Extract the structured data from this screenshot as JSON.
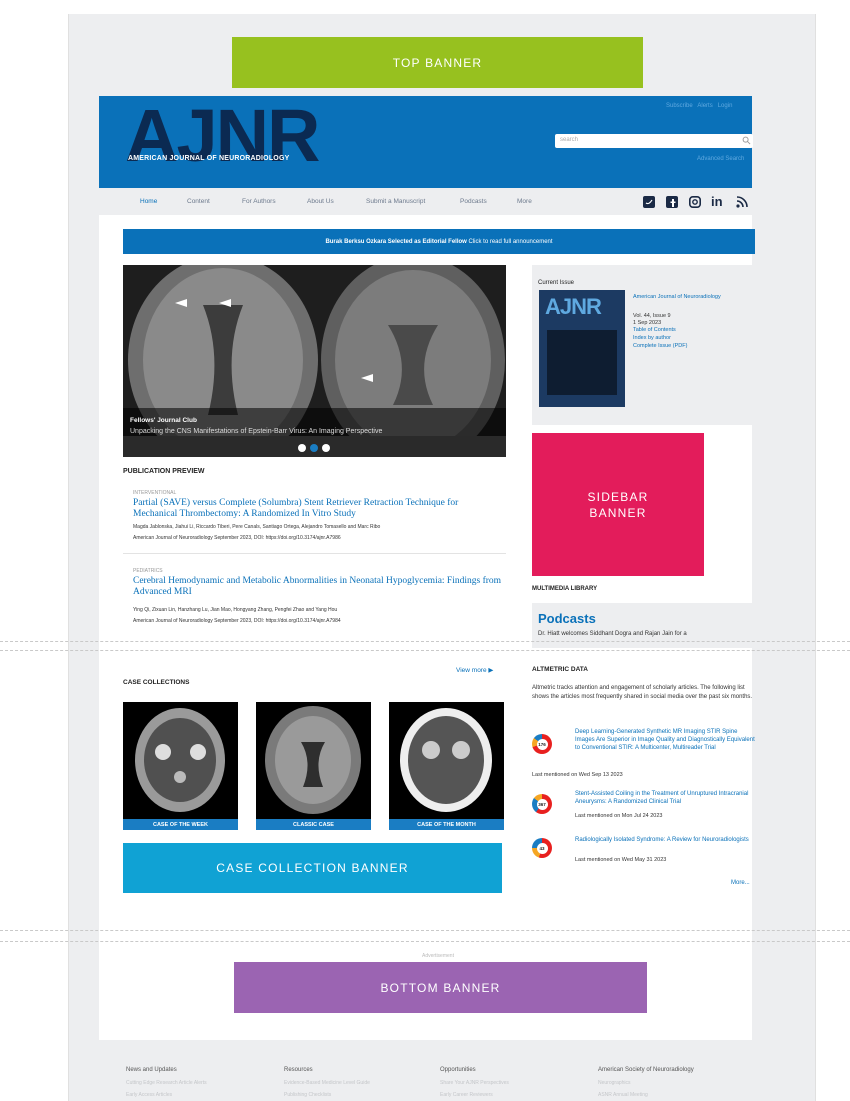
{
  "banners": {
    "top": "TOP BANNER",
    "sidebar": "SIDEBAR\nBANNER",
    "case_collection": "CASE COLLECTION BANNER",
    "bottom": "BOTTOM BANNER",
    "advertisement": "Advertisement"
  },
  "header": {
    "logo": "AJNR",
    "logo_subtitle": "AMERICAN JOURNAL OF NEURORADIOLOGY",
    "utility_links": [
      "Subscribe",
      "Alerts",
      "Login"
    ],
    "search_placeholder": "search",
    "advanced_search": "Advanced Search"
  },
  "nav": {
    "items": [
      "Home",
      "Content",
      "For Authors",
      "About Us",
      "Submit a Manuscript",
      "Podcasts",
      "More"
    ],
    "social_icons": [
      "twitter-icon",
      "facebook-icon",
      "instagram-icon",
      "linkedin-icon",
      "rss-icon"
    ]
  },
  "announcement": {
    "bold": "Burak Berksu Ozkara Selected as Editorial Fellow",
    "link": "Click to read full announcement"
  },
  "carousel": {
    "caption_title": "Fellows' Journal Club",
    "caption_subtitle": "Unpacking the CNS Manifestations of Epstein-Barr Virus: An Imaging Perspective"
  },
  "publication_preview": {
    "heading": "PUBLICATION PREVIEW",
    "articles": [
      {
        "category": "INTERVENTIONAL",
        "title": "Partial (SAVE) versus Complete (Solumbra) Stent Retriever Retraction Technique for Mechanical Thrombectomy: A Randomized In Vitro Study",
        "authors": "Magda Jablonska, Jiahui Li, Riccardo Tiberi, Pere Canals, Santiago Ortega, Alejandro Tomasello and Marc Ribo",
        "citation": "American Journal of Neuroradiology September 2023, DOI: https://doi.org/10.3174/ajnr.A7986"
      },
      {
        "category": "PEDIATRICS",
        "title": "Cerebral Hemodynamic and Metabolic Abnormalities in Neonatal Hypoglycemia: Findings from Advanced MRI",
        "authors": "Ying Qi, Zixuan Lin, Hanzhang Lu, Jian Mao, Hongyang Zhang, Pengfei Zhao and Yang Hou",
        "citation": "American Journal of Neuroradiology September 2023, DOI: https://doi.org/10.3174/ajnr.A7984"
      }
    ]
  },
  "current_issue": {
    "heading": "Current Issue",
    "cover_logo": "AJNR",
    "journal": "American Journal of Neuroradiology",
    "volume": "Vol. 44, Issue 9",
    "date": "1 Sep 2023",
    "links": [
      "Table of Contents",
      "Index by author",
      "Complete Issue (PDF)"
    ]
  },
  "multimedia": {
    "heading": "MULTIMEDIA LIBRARY",
    "podcasts_title": "Podcasts",
    "podcasts_text": "Dr. Hiatt welcomes Siddhant Dogra and Rajan Jain for a"
  },
  "case_collections": {
    "view_more": "View more",
    "heading": "CASE COLLECTIONS",
    "items": [
      "CASE OF THE WEEK",
      "CLASSIC CASE",
      "CASE OF THE MONTH"
    ]
  },
  "altmetric": {
    "heading": "ALTMETRIC DATA",
    "description": "Altmetric tracks attention and engagement of scholarly articles. The following list shows the articles most frequently shared in social media over the past six months.",
    "items": [
      {
        "score": "176",
        "title": "Deep Learning-Generated Synthetic MR Imaging STIR Spine Images Are Superior in Image Quality and Diagnostically Equivalent to Conventional STIR: A Multicenter, Multireader Trial",
        "date": "Last mentioned on Wed Sep 13 2023"
      },
      {
        "score": "367",
        "title": "Stent-Assisted Coiling in the Treatment of Unruptured Intracranial Aneurysms: A Randomized Clinical Trial",
        "date": "Last mentioned on Mon Jul 24 2023"
      },
      {
        "score": "43",
        "title": "Radiologically Isolated Syndrome: A Review for Neuroradiologists",
        "date": "Last mentioned on Wed May 31 2023"
      }
    ],
    "more": "More..."
  },
  "footer": {
    "columns": [
      {
        "heading": "News and Updates",
        "links": [
          "Cutting Edge Research Article Alerts",
          "Early Access Articles"
        ]
      },
      {
        "heading": "Resources",
        "links": [
          "Evidence-Based Medicine Level Guide",
          "Publishing Checklists"
        ]
      },
      {
        "heading": "Opportunities",
        "links": [
          "Share Your AJNR Perspectives",
          "Early Career Reviewers"
        ]
      },
      {
        "heading": "American Society of Neuroradiology",
        "links": [
          "Neurographics",
          "ASNR Annual Meeting"
        ]
      }
    ]
  },
  "colors": {
    "brand_blue": "#0a71b9",
    "logo_navy": "#0b2a52",
    "top_banner": "#97c11f",
    "sidebar_banner": "#e31c5b",
    "case_banner": "#10a2d4",
    "bottom_banner": "#9b64b2"
  }
}
